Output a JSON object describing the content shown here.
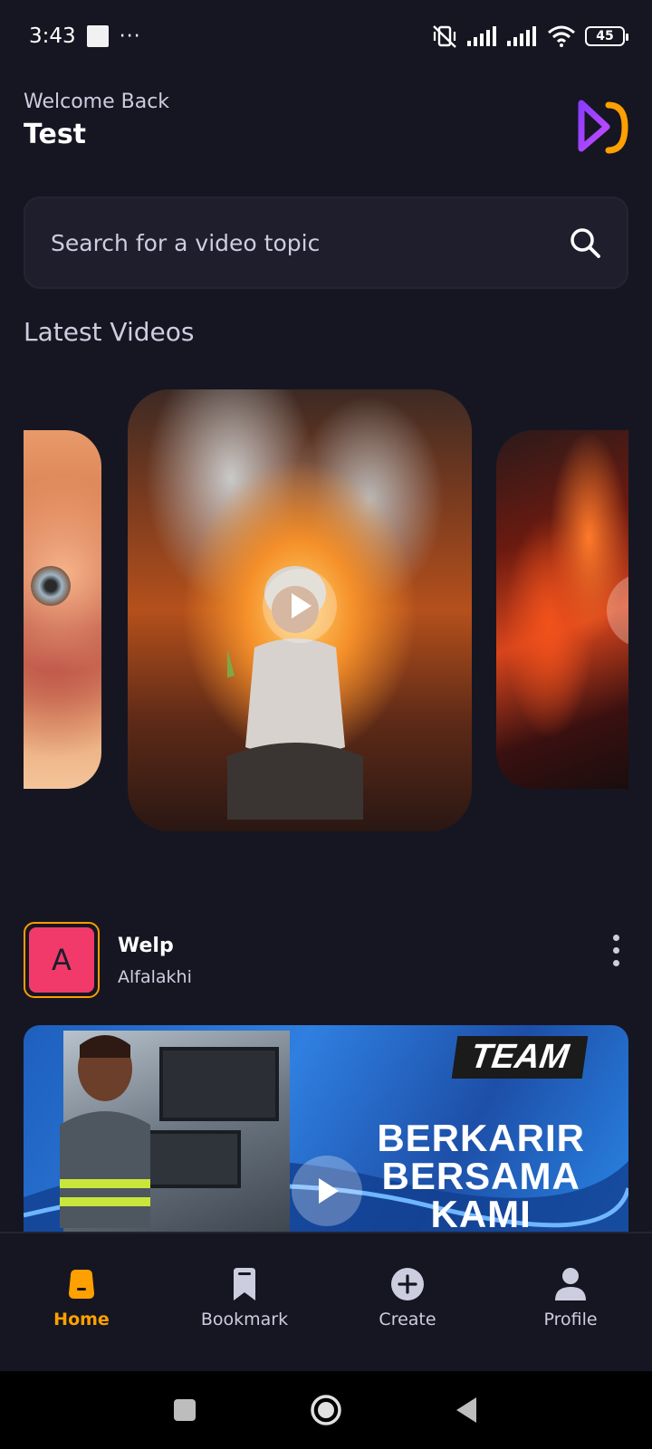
{
  "status_bar": {
    "time": "3:43",
    "dots": "···",
    "battery": "45"
  },
  "header": {
    "welcome": "Welcome Back",
    "username": "Test"
  },
  "search": {
    "placeholder": "Search for a video topic"
  },
  "latest_videos": {
    "title": "Latest Videos"
  },
  "post": {
    "avatar_letter": "A",
    "title": "Welp",
    "author": "Alfalakhi",
    "thumbnail": {
      "badge": "TEAM",
      "line1": "BERKARIR",
      "line2": "BERSAMA",
      "line3": "KAMI"
    }
  },
  "tabs": [
    {
      "label": "Home",
      "icon": "home-icon",
      "active": true
    },
    {
      "label": "Bookmark",
      "icon": "bookmark-icon",
      "active": false
    },
    {
      "label": "Create",
      "icon": "plus-circle-icon",
      "active": false
    },
    {
      "label": "Profile",
      "icon": "profile-icon",
      "active": false
    }
  ],
  "colors": {
    "background": "#161622",
    "accent": "#FFA001",
    "secondary_text": "#CDCDE0",
    "search_bg": "#1E1E2D",
    "avatar_bg": "#F13A6A"
  }
}
